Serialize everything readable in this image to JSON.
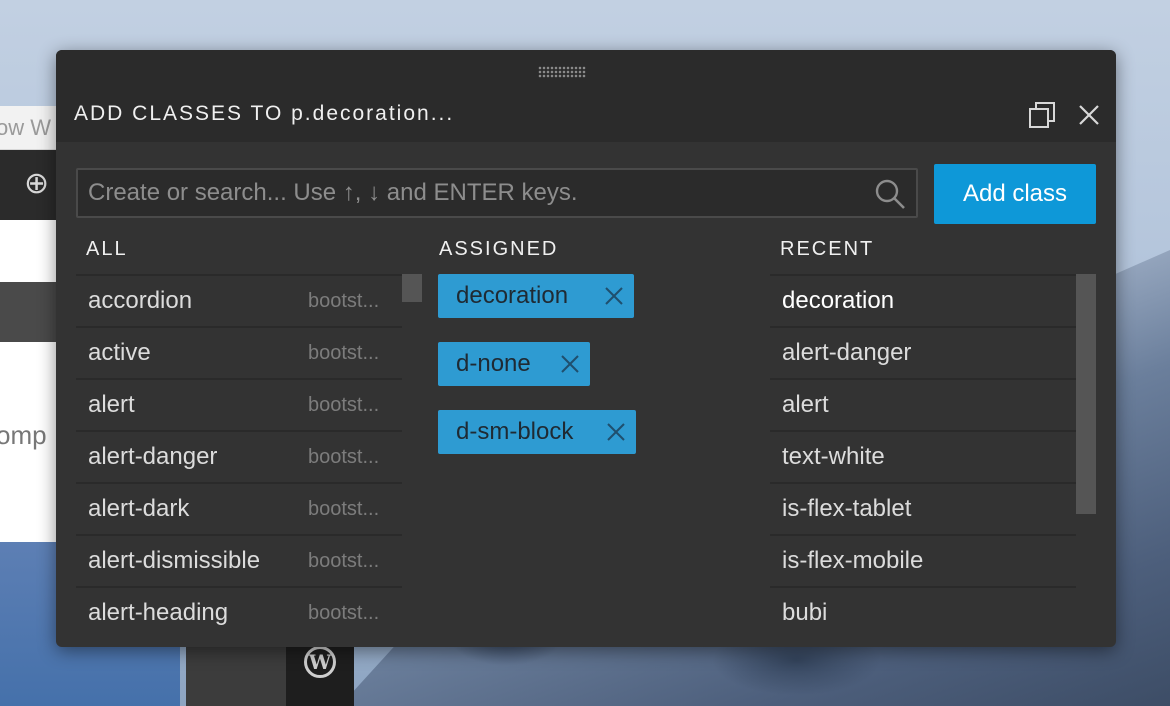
{
  "background": {
    "window_title_fragment": "ow W",
    "page_text_fragment": "omp"
  },
  "dialog": {
    "title": "ADD CLASSES TO p.decoration...",
    "search": {
      "placeholder": "Create or search... Use ↑, ↓ and ENTER keys.",
      "value": ""
    },
    "add_button_label": "Add class",
    "columns": {
      "all": {
        "heading": "ALL",
        "items": [
          {
            "name": "accordion",
            "source": "bootst..."
          },
          {
            "name": "active",
            "source": "bootst..."
          },
          {
            "name": "alert",
            "source": "bootst..."
          },
          {
            "name": "alert-danger",
            "source": "bootst..."
          },
          {
            "name": "alert-dark",
            "source": "bootst..."
          },
          {
            "name": "alert-dismissible",
            "source": "bootst..."
          },
          {
            "name": "alert-heading",
            "source": "bootst..."
          }
        ]
      },
      "assigned": {
        "heading": "ASSIGNED",
        "tags": [
          "decoration",
          "d-none",
          "d-sm-block"
        ]
      },
      "recent": {
        "heading": "RECENT",
        "items": [
          "decoration",
          "alert-danger",
          "alert",
          "text-white",
          "is-flex-tablet",
          "is-flex-mobile",
          "bubi"
        ]
      }
    }
  },
  "colors": {
    "accent": "#0e98d8",
    "tag": "#2e9bd2",
    "dialog_bg": "#333333"
  }
}
